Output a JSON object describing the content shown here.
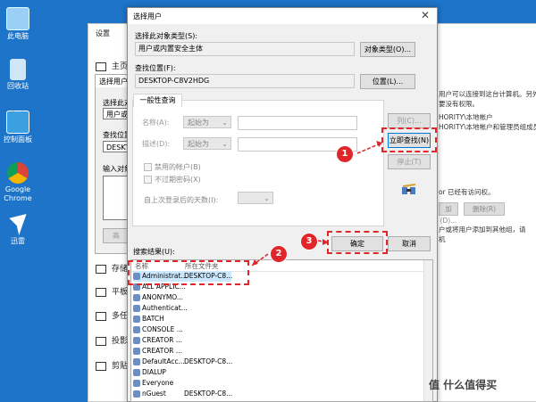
{
  "desktop": {
    "icons": [
      {
        "label": "此电脑"
      },
      {
        "label": "回收站"
      },
      {
        "label": "控制面板"
      },
      {
        "label": "Google Chrome"
      },
      {
        "label": "迅雷"
      }
    ]
  },
  "settings": {
    "title": "设置",
    "home": "主页",
    "nav": [
      "存储",
      "平板",
      "多任",
      "投影",
      "剪贴"
    ],
    "right_texts": [
      "用户可以连接到这台计算机。另外,",
      "要没有权限。",
      "HORITY\\本地帐户",
      "HORITY\\本地帐户和管理员组成员",
      "or 已经有访问权。",
      "户或将用户添加到其他组，请",
      "机"
    ],
    "btn_add": "加(D)...",
    "btn_delete": "删除(R)"
  },
  "behind_dialog": {
    "title": "选择用户",
    "lines": [
      "选择此对",
      "用户或内",
      "查找位置",
      "DESKTOP",
      "输入对象"
    ],
    "btn": "高"
  },
  "dialog": {
    "title": "选择用户",
    "object_type_label": "选择此对象类型(S):",
    "object_type_value": "用户或内置安全主体",
    "object_type_button": "对象类型(O)...",
    "location_label": "查找位置(F):",
    "location_value": "DESKTOP-C8V2HDG",
    "location_button": "位置(L)...",
    "tab_label": "一般性查询",
    "name_label": "名称(A):",
    "desc_label": "描述(D):",
    "starts_with": "起始为",
    "columns_button": "列(C)...",
    "find_now_button": "立即查找(N)",
    "stop_button": "停止(T)",
    "disabled_accounts": "禁用的帐户(B)",
    "non_expiring": "不过期密码(X)",
    "days_since_login": "自上次登录后的天数(I):",
    "ok_button": "确定",
    "cancel_button": "取消",
    "results_label": "搜索结果(U):",
    "col_name": "名称",
    "col_folder": "所在文件夹",
    "rows": [
      {
        "name": "Administrat...",
        "folder": "DESKTOP-C8..."
      },
      {
        "name": "ALL APPLIC...",
        "folder": ""
      },
      {
        "name": "ANONYMO...",
        "folder": ""
      },
      {
        "name": "Authenticat...",
        "folder": ""
      },
      {
        "name": "BATCH",
        "folder": ""
      },
      {
        "name": "CONSOLE ...",
        "folder": ""
      },
      {
        "name": "CREATOR ...",
        "folder": ""
      },
      {
        "name": "CREATOR ...",
        "folder": ""
      },
      {
        "name": "DefaultAcc...",
        "folder": "DESKTOP-C8..."
      },
      {
        "name": "DIALUP",
        "folder": ""
      },
      {
        "name": "Everyone",
        "folder": ""
      },
      {
        "name": "nGuest",
        "folder": "DESKTOP-C8..."
      }
    ]
  },
  "annotations": {
    "badge1": "1",
    "badge2": "2",
    "badge3": "3"
  },
  "watermark": "值 什么值得买",
  "colors": {
    "desktop": "#1e74c8",
    "annotation_red": "#e0262a",
    "selection": "#cce8ff"
  }
}
